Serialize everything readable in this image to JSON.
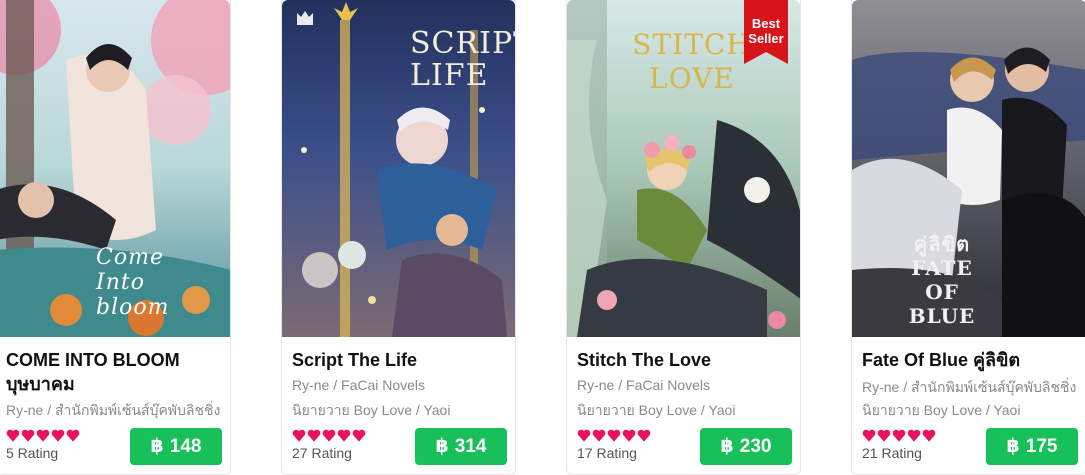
{
  "colors": {
    "accent": "#18c05a",
    "heart": "#e8135f",
    "badge": "#d6141a"
  },
  "currency_symbol": "฿",
  "books": [
    {
      "title": "COME INTO BLOOM บุษบาคม",
      "cover_text": "Come Into bloom",
      "byline": "Ry-ne / สำนักพิมพ์เซ้นส์บุ๊คพับลิชชิ่ง",
      "category": "",
      "rating_text": "5 Rating",
      "stars": 5,
      "price": "148",
      "badge": ""
    },
    {
      "title": "Script The Life",
      "cover_text": "SCRIPT LIFE",
      "byline": "Ry-ne / FaCai Novels",
      "category": "นิยายวาย Boy Love / Yaoi",
      "rating_text": "27 Rating",
      "stars": 5,
      "price": "314",
      "badge": ""
    },
    {
      "title": "Stitch The Love",
      "cover_text": "STITCH LOVE",
      "byline": "Ry-ne / FaCai Novels",
      "category": "นิยายวาย Boy Love / Yaoi",
      "rating_text": "17 Rating",
      "stars": 5,
      "price": "230",
      "badge": "Best Seller"
    },
    {
      "title": "Fate Of Blue คู่ลิขิต",
      "cover_text": "คู่ลิขิต FATE OF BLUE",
      "byline": "Ry-ne / สำนักพิมพ์เซ้นส์บุ๊คพับลิชชิ่ง",
      "category": "นิยายวาย Boy Love / Yaoi",
      "rating_text": "21 Rating",
      "stars": 5,
      "price": "175",
      "badge": ""
    }
  ]
}
